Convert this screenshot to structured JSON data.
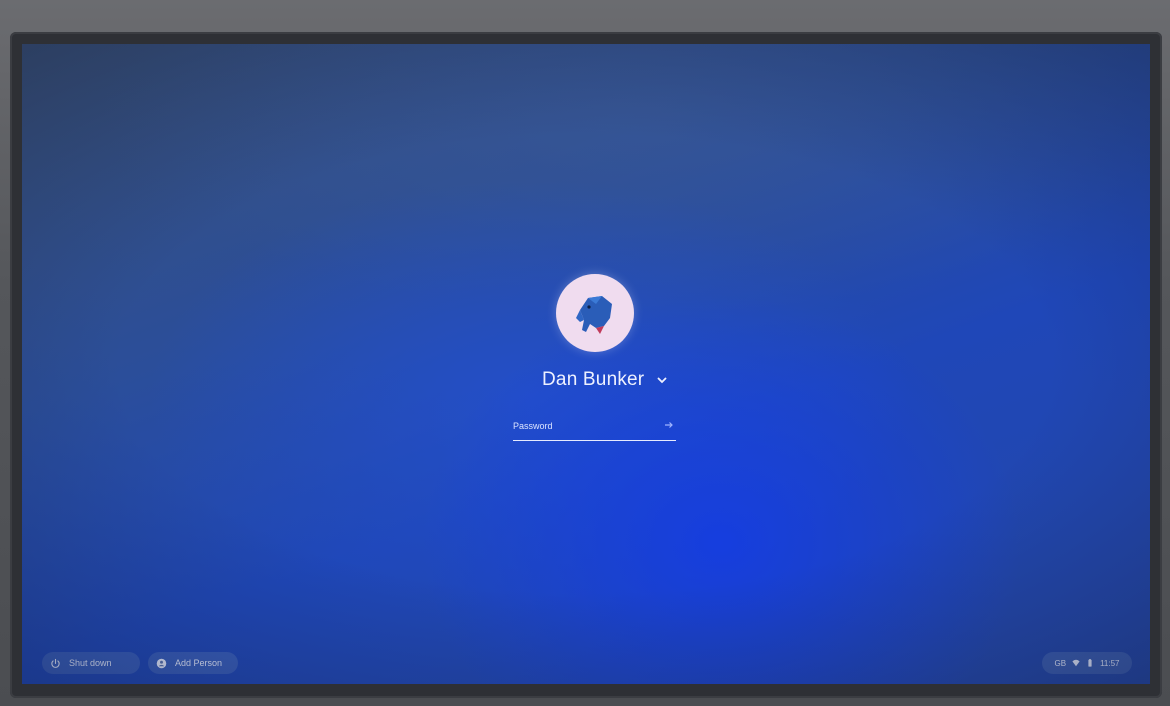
{
  "login": {
    "user_name": "Dan Bunker",
    "password_placeholder": "Password"
  },
  "shelf": {
    "shutdown_label": "Shut down",
    "add_person_label": "Add Person"
  },
  "status": {
    "keyboard_layout": "GB",
    "time": "11:57"
  },
  "icons": {
    "avatar": "elephant-avatar-icon",
    "user_menu": "chevron-down-icon",
    "submit": "arrow-right-icon",
    "shutdown": "power-icon",
    "add_person": "add-person-icon",
    "wifi": "wifi-icon",
    "battery": "battery-icon"
  },
  "colors": {
    "background_blue": "#1f47b8",
    "avatar_bg": "#f0dcef",
    "text": "#eef1ff"
  }
}
